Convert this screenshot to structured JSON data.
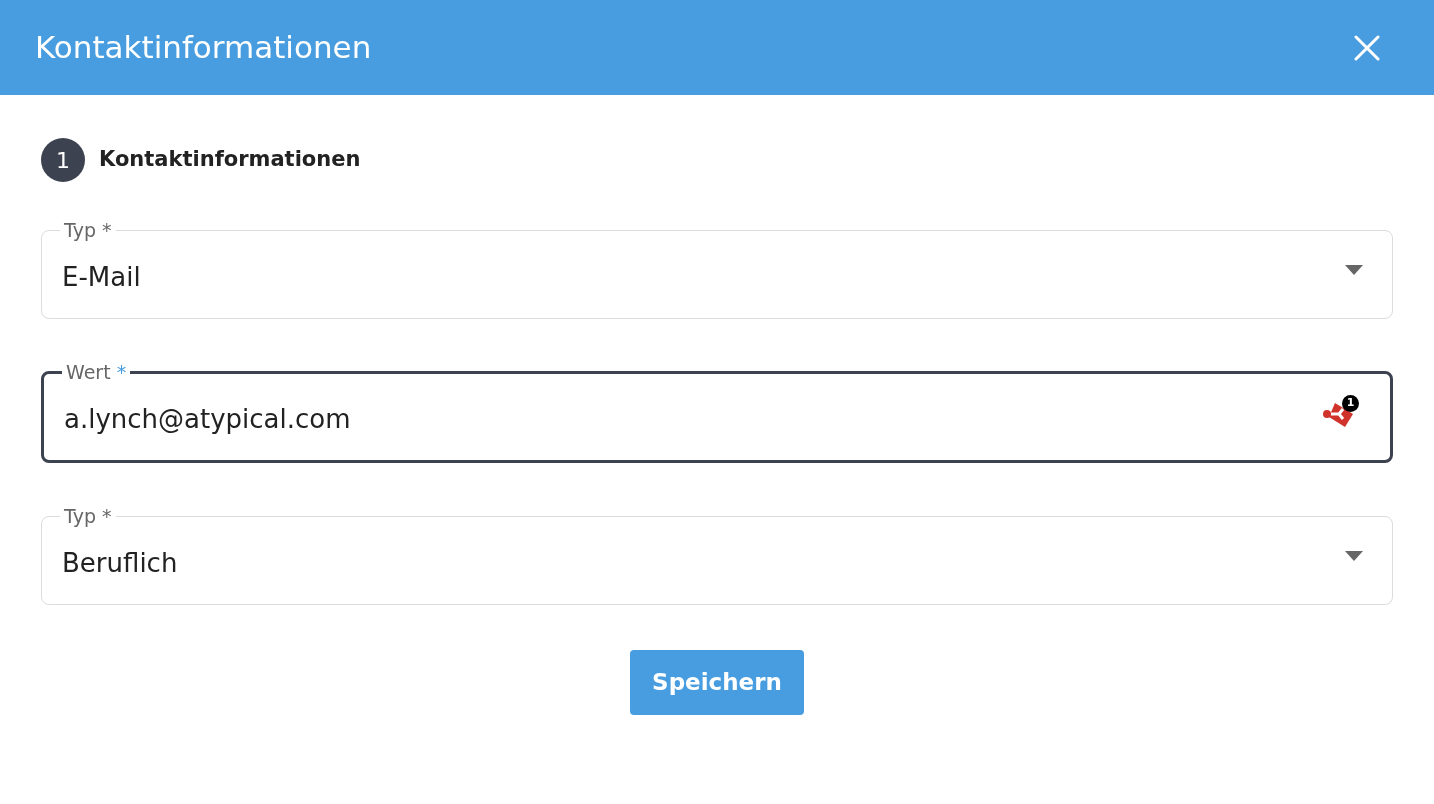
{
  "dialog": {
    "title": "Kontaktinformationen"
  },
  "step": {
    "number": "1",
    "title": "Kontaktinformationen"
  },
  "fields": [
    {
      "kind": "select",
      "label": "Typ",
      "required_mark": "*",
      "value": "E-Mail",
      "focused": false
    },
    {
      "kind": "text",
      "label": "Wert",
      "required_mark": "*",
      "value": "a.lynch@atypical.com",
      "focused": true,
      "extension_badge": "1"
    },
    {
      "kind": "select",
      "label": "Typ",
      "required_mark": "*",
      "value": "Beruflich",
      "focused": false
    }
  ],
  "buttons": [
    "Speichern"
  ]
}
